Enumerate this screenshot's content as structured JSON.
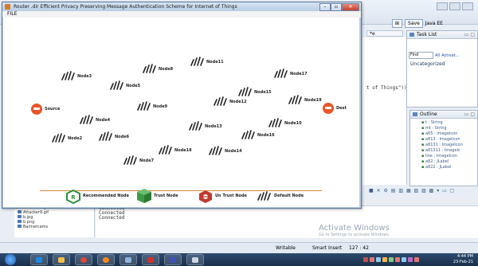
{
  "app": {
    "title": "Router .dir Efficient Privacy Preserving Message Authentication Scheme for Internet of Things",
    "menu_file": "FILE",
    "source_label": "Source",
    "dest_label": "Dest",
    "nodes": [
      {
        "label": "Node3"
      },
      {
        "label": "Node8"
      },
      {
        "label": "Node11"
      },
      {
        "label": "Node17"
      },
      {
        "label": "Node5"
      },
      {
        "label": "Node9"
      },
      {
        "label": "Node12"
      },
      {
        "label": "Node15"
      },
      {
        "label": "Node19"
      },
      {
        "label": "Node4"
      },
      {
        "label": "Node13"
      },
      {
        "label": "Node10"
      },
      {
        "label": "Node2"
      },
      {
        "label": "Node6"
      },
      {
        "label": "Node16"
      },
      {
        "label": "Node7"
      },
      {
        "label": "Node18"
      },
      {
        "label": "Node14"
      }
    ],
    "legend": {
      "recommended": "Recommended Node",
      "trust": "Trust Node",
      "untrust": "Un Trust Node",
      "default": "Default Node"
    },
    "colors": {
      "source": "#e8572a",
      "recommended_green": "#2f8f3a",
      "trust_green": "#3e9b45",
      "untrust_red": "#c23a2f",
      "separator": "#d48a3a"
    }
  },
  "eclipse": {
    "save_label": "Save",
    "java_label": "Java EE",
    "editor_tab": "*e",
    "code_fragment": "t of Things\"))",
    "task_list_title": "Task List",
    "find_placeholder": "Find",
    "find_all": "All",
    "find_activate": "Activat...",
    "uncategorized": "Uncategorized",
    "outline_title": "Outline",
    "outline_items": [
      "t : String",
      "mt : String",
      "a65 : ImageIcon",
      "a813 : ImageIcon",
      "a8131 : ImageIcon",
      "a81311 : ImageIc",
      "line : ImageIcon",
      "a82 : JLabel",
      "a822 : JLabel"
    ],
    "files": [
      "Attacker8.gif",
      "Attacker9.gif",
      "b.jpg",
      "b.png",
      "Bannercams"
    ],
    "console_lines": [
      "Connected",
      "Connected",
      "Connected"
    ],
    "activate_title": "Activate Windows",
    "activate_sub": "Go to Settings to activate Windows.",
    "status_writable": "Writable",
    "status_insert": "Smart Insert",
    "status_pos": "127 : 42"
  },
  "taskbar": {
    "time": "4:44 PM",
    "date": "23-Feb-21"
  }
}
